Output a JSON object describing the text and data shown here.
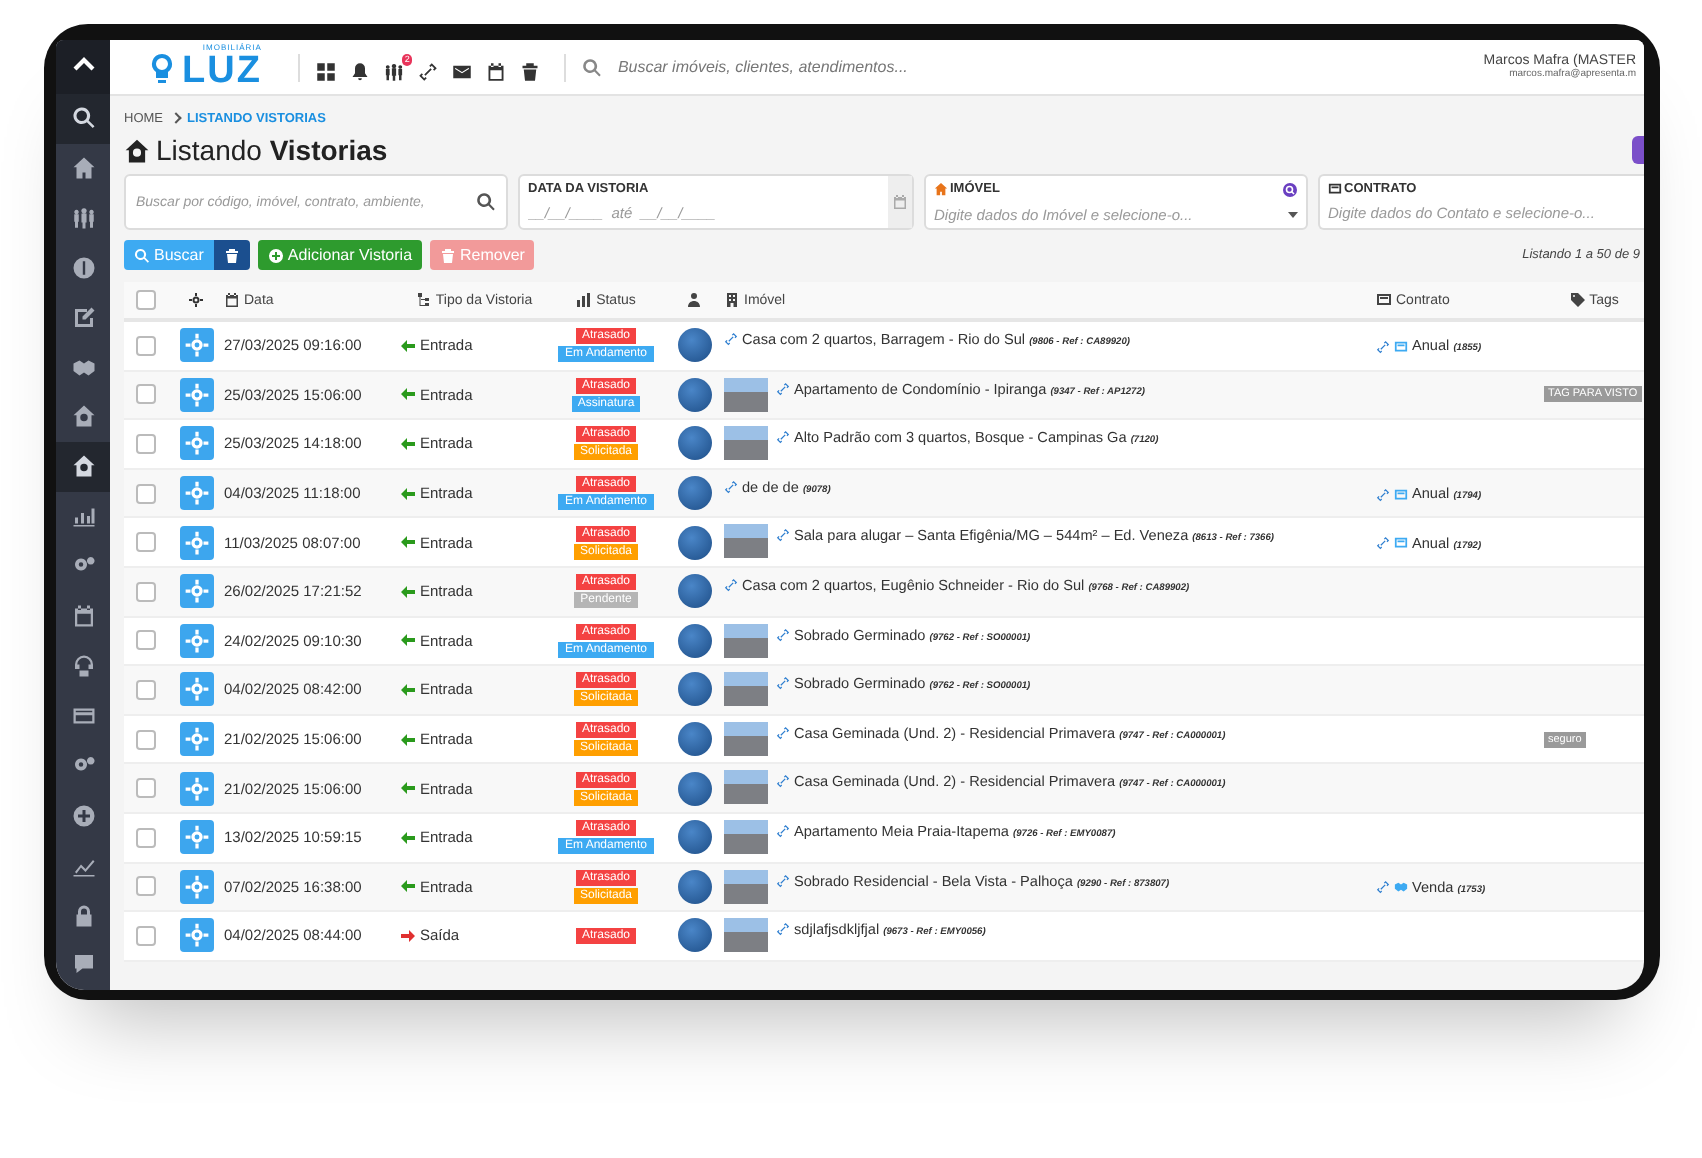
{
  "header": {
    "logo_top": "IMOBILIÁRIA",
    "logo": "LUZ",
    "toolbar": [
      {
        "kind": "grid"
      },
      {
        "kind": "bell"
      },
      {
        "kind": "people",
        "badge": "2"
      },
      {
        "kind": "link"
      },
      {
        "kind": "mail"
      },
      {
        "kind": "calendar"
      },
      {
        "kind": "trash"
      }
    ],
    "search": {
      "placeholder": "Buscar imóveis, clientes, atendimentos..."
    },
    "user": {
      "name": "Marcos Mafra (MASTER",
      "email": "marcos.mafra@apresenta.m"
    }
  },
  "sidebar": {
    "items": [
      {
        "kind": "search",
        "selected": true
      },
      {
        "kind": "home",
        "selected": false
      },
      {
        "kind": "people",
        "selected": false
      },
      {
        "kind": "dollar",
        "selected": false
      },
      {
        "kind": "edit",
        "selected": false
      },
      {
        "kind": "handshake",
        "selected": false
      },
      {
        "kind": "housesearch",
        "selected": false
      },
      {
        "kind": "housesearch",
        "selected": true
      },
      {
        "kind": "chart",
        "selected": false
      },
      {
        "kind": "gears",
        "selected": false
      },
      {
        "kind": "calendar",
        "selected": false
      },
      {
        "kind": "support",
        "selected": false
      },
      {
        "kind": "card",
        "selected": false
      },
      {
        "kind": "gears",
        "selected": false
      },
      {
        "kind": "plus",
        "selected": false
      },
      {
        "kind": "chartup",
        "selected": false
      },
      {
        "kind": "lock",
        "selected": false
      },
      {
        "kind": "chat",
        "selected": false
      }
    ]
  },
  "breadcrumb": [
    "HOME",
    "LISTANDO VISTORIAS"
  ],
  "title": "Listando **Vistorias**",
  "filters": {
    "search": {
      "placeholder": "Buscar por código, imóvel, contrato, ambiente,"
    },
    "date": {
      "label": "DATA DA VISTORIA",
      "placeholder": "__/__/____  até  __/__/____"
    },
    "property": {
      "label": "IMÓVEL",
      "placeholder": "Digite dados do Imóvel e selecione-o..."
    },
    "contract": {
      "label": "CONTRATO",
      "placeholder": "Digite dados do Contato e selecione-o..."
    }
  },
  "actions": [
    {
      "kind": "search",
      "label": "Buscar",
      "disabled": false
    },
    {
      "kind": "trash",
      "disabled": false
    },
    {
      "kind": "add",
      "label": "Adicionar Vistoria",
      "disabled": false
    },
    {
      "kind": "remove",
      "label": "Remover",
      "disabled": true
    }
  ],
  "listing": "Listando 1 a 50 de 9",
  "table": {
    "columns": [
      {
        "kind": "check",
        "checked": false
      },
      {
        "kind": "gear"
      },
      {
        "kind": "date",
        "label": "Data"
      },
      {
        "kind": "type",
        "label": "Tipo da Vistoria"
      },
      {
        "kind": "status",
        "label": "Status"
      },
      {
        "kind": "person"
      },
      {
        "kind": "property",
        "label": "Imóvel"
      },
      {
        "kind": "contract",
        "label": "Contrato"
      },
      {
        "kind": "tags",
        "label": "Tags"
      }
    ],
    "rows": [
      {
        "checked": false,
        "date": "27/03/2025 09:16:00",
        "type": {
          "kind": "entrada",
          "label": "Entrada"
        },
        "status": [
          {
            "label": "Atrasado",
            "color": "#f44242"
          },
          {
            "label": "Em Andamento",
            "color": "#3daaf2"
          }
        ],
        "property": {
          "photo": false,
          "name": "Casa com 2 quartos, Barragem - Rio do Sul",
          "ref": "(9806 - Ref : CA89920)"
        },
        "contract": {
          "kind": "doc",
          "label": "Anual",
          "ref": "(1855)"
        }
      },
      {
        "checked": false,
        "date": "25/03/2025 15:06:00",
        "type": {
          "kind": "entrada",
          "label": "Entrada"
        },
        "status": [
          {
            "label": "Atrasado",
            "color": "#f44242"
          },
          {
            "label": "Assinatura",
            "color": "#3daaf2"
          }
        ],
        "property": {
          "photo": true,
          "name": "Apartamento de Condomínio - Ipiranga",
          "ref": "(9347 - Ref : AP1272)"
        },
        "tags": [
          {
            "label": "TAG PARA VISTO"
          }
        ]
      },
      {
        "checked": false,
        "date": "25/03/2025 14:18:00",
        "type": {
          "kind": "entrada",
          "label": "Entrada"
        },
        "status": [
          {
            "label": "Atrasado",
            "color": "#f44242"
          },
          {
            "label": "Solicitada",
            "color": "#ff9f00"
          }
        ],
        "property": {
          "photo": true,
          "name": "Alto Padrão com 3 quartos, Bosque - Campinas Ga",
          "ref": "(7120)"
        }
      },
      {
        "checked": false,
        "date": "04/03/2025 11:18:00",
        "type": {
          "kind": "entrada",
          "label": "Entrada"
        },
        "status": [
          {
            "label": "Atrasado",
            "color": "#f44242"
          },
          {
            "label": "Em Andamento",
            "color": "#3daaf2"
          }
        ],
        "property": {
          "photo": false,
          "name": "de de de",
          "ref": "(9078)"
        },
        "contract": {
          "kind": "doc",
          "label": "Anual",
          "ref": "(1794)"
        }
      },
      {
        "checked": false,
        "date": "11/03/2025 08:07:00",
        "type": {
          "kind": "entrada",
          "label": "Entrada"
        },
        "status": [
          {
            "label": "Atrasado",
            "color": "#f44242"
          },
          {
            "label": "Solicitada",
            "color": "#ff9f00"
          }
        ],
        "property": {
          "photo": true,
          "name": "Sala para alugar – Santa Efigênia/MG – 544m² – Ed. Veneza",
          "ref": "(8613 - Ref : 7366)"
        },
        "contract": {
          "kind": "doc",
          "label": "Anual",
          "ref": "(1792)"
        }
      },
      {
        "checked": false,
        "date": "26/02/2025 17:21:52",
        "type": {
          "kind": "entrada",
          "label": "Entrada"
        },
        "status": [
          {
            "label": "Atrasado",
            "color": "#f44242"
          },
          {
            "label": "Pendente",
            "color": "#b5b5b5"
          }
        ],
        "property": {
          "photo": false,
          "name": "Casa com 2 quartos, Eugênio Schneider - Rio do Sul",
          "ref": "(9768 - Ref : CA89902)"
        }
      },
      {
        "checked": false,
        "date": "24/02/2025 09:10:30",
        "type": {
          "kind": "entrada",
          "label": "Entrada"
        },
        "status": [
          {
            "label": "Atrasado",
            "color": "#f44242"
          },
          {
            "label": "Em Andamento",
            "color": "#3daaf2"
          }
        ],
        "property": {
          "photo": true,
          "name": "Sobrado Germinado",
          "ref": "(9762 - Ref : SO00001)"
        }
      },
      {
        "checked": false,
        "date": "04/02/2025 08:42:00",
        "type": {
          "kind": "entrada",
          "label": "Entrada"
        },
        "status": [
          {
            "label": "Atrasado",
            "color": "#f44242"
          },
          {
            "label": "Solicitada",
            "color": "#ff9f00"
          }
        ],
        "property": {
          "photo": true,
          "name": "Sobrado Germinado",
          "ref": "(9762 - Ref : SO00001)"
        }
      },
      {
        "checked": false,
        "date": "21/02/2025 15:06:00",
        "type": {
          "kind": "entrada",
          "label": "Entrada"
        },
        "status": [
          {
            "label": "Atrasado",
            "color": "#f44242"
          },
          {
            "label": "Solicitada",
            "color": "#ff9f00"
          }
        ],
        "property": {
          "photo": true,
          "name": "Casa Geminada (Und. 2) - Residencial Primavera",
          "ref": "(9747 - Ref : CA000001)"
        },
        "tags": [
          {
            "label": "seguro"
          }
        ]
      },
      {
        "checked": false,
        "date": "21/02/2025 15:06:00",
        "type": {
          "kind": "entrada",
          "label": "Entrada"
        },
        "status": [
          {
            "label": "Atrasado",
            "color": "#f44242"
          },
          {
            "label": "Solicitada",
            "color": "#ff9f00"
          }
        ],
        "property": {
          "photo": true,
          "name": "Casa Geminada (Und. 2) - Residencial Primavera",
          "ref": "(9747 - Ref : CA000001)"
        }
      },
      {
        "checked": false,
        "date": "13/02/2025 10:59:15",
        "type": {
          "kind": "entrada",
          "label": "Entrada"
        },
        "status": [
          {
            "label": "Atrasado",
            "color": "#f44242"
          },
          {
            "label": "Em Andamento",
            "color": "#3daaf2"
          }
        ],
        "property": {
          "photo": true,
          "name": "Apartamento Meia Praia-Itapema",
          "ref": "(9726 - Ref : EMY0087)"
        }
      },
      {
        "checked": false,
        "date": "07/02/2025 16:38:00",
        "type": {
          "kind": "entrada",
          "label": "Entrada"
        },
        "status": [
          {
            "label": "Atrasado",
            "color": "#f44242"
          },
          {
            "label": "Solicitada",
            "color": "#ff9f00"
          }
        ],
        "property": {
          "photo": true,
          "name": "Sobrado Residencial - Bela Vista - Palhoça",
          "ref": "(9290 - Ref : 873807)"
        },
        "contract": {
          "kind": "handshake",
          "label": "Venda",
          "ref": "(1753)"
        }
      },
      {
        "checked": false,
        "date": "04/02/2025 08:44:00",
        "type": {
          "kind": "saida",
          "label": "Saída"
        },
        "status": [
          {
            "label": "Atrasado",
            "color": "#f44242"
          }
        ],
        "property": {
          "photo": true,
          "name": "sdjlafjsdkljfjal",
          "ref": "(9673 - Ref : EMY0056)"
        }
      }
    ]
  }
}
